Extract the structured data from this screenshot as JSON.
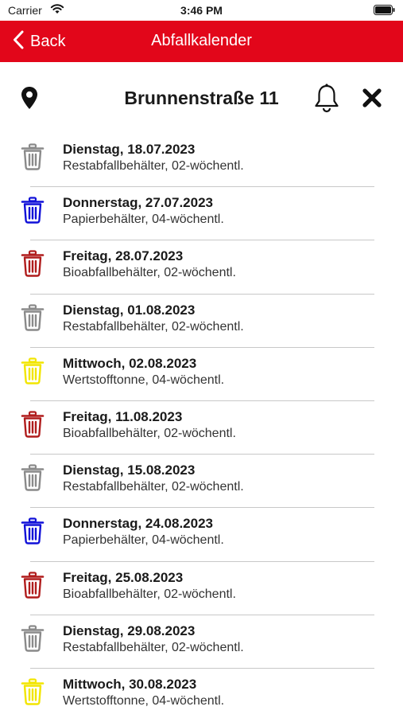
{
  "status_bar": {
    "carrier": "Carrier",
    "time": "3:46 PM"
  },
  "nav": {
    "back_label": "Back",
    "title": "Abfallkalender"
  },
  "header": {
    "address": "Brunnenstraße 11"
  },
  "colors": {
    "nav_bar": "#e2061a",
    "restabfall": "#8a8a8a",
    "papier": "#1010d8",
    "bio": "#b01c1c",
    "wertstoff": "#f2e500"
  },
  "entries": [
    {
      "date": "Dienstag, 18.07.2023",
      "type": "Restabfallbehälter, 02-wöchentl.",
      "bin_color": "#8a8a8a",
      "icon": "trash-icon-grey"
    },
    {
      "date": "Donnerstag, 27.07.2023",
      "type": "Papierbehälter, 04-wöchentl.",
      "bin_color": "#1010d8",
      "icon": "trash-icon-blue"
    },
    {
      "date": "Freitag, 28.07.2023",
      "type": "Bioabfallbehälter, 02-wöchentl.",
      "bin_color": "#b01c1c",
      "icon": "trash-icon-red"
    },
    {
      "date": "Dienstag, 01.08.2023",
      "type": "Restabfallbehälter, 02-wöchentl.",
      "bin_color": "#8a8a8a",
      "icon": "trash-icon-grey"
    },
    {
      "date": "Mittwoch, 02.08.2023",
      "type": "Wertstofftonne, 04-wöchentl.",
      "bin_color": "#f2e500",
      "icon": "trash-icon-yellow"
    },
    {
      "date": "Freitag, 11.08.2023",
      "type": "Bioabfallbehälter, 02-wöchentl.",
      "bin_color": "#b01c1c",
      "icon": "trash-icon-red"
    },
    {
      "date": "Dienstag, 15.08.2023",
      "type": "Restabfallbehälter, 02-wöchentl.",
      "bin_color": "#8a8a8a",
      "icon": "trash-icon-grey"
    },
    {
      "date": "Donnerstag, 24.08.2023",
      "type": "Papierbehälter, 04-wöchentl.",
      "bin_color": "#1010d8",
      "icon": "trash-icon-blue"
    },
    {
      "date": "Freitag, 25.08.2023",
      "type": "Bioabfallbehälter, 02-wöchentl.",
      "bin_color": "#b01c1c",
      "icon": "trash-icon-red"
    },
    {
      "date": "Dienstag, 29.08.2023",
      "type": "Restabfallbehälter, 02-wöchentl.",
      "bin_color": "#8a8a8a",
      "icon": "trash-icon-grey"
    },
    {
      "date": "Mittwoch, 30.08.2023",
      "type": "Wertstofftonne, 04-wöchentl.",
      "bin_color": "#f2e500",
      "icon": "trash-icon-yellow"
    }
  ]
}
